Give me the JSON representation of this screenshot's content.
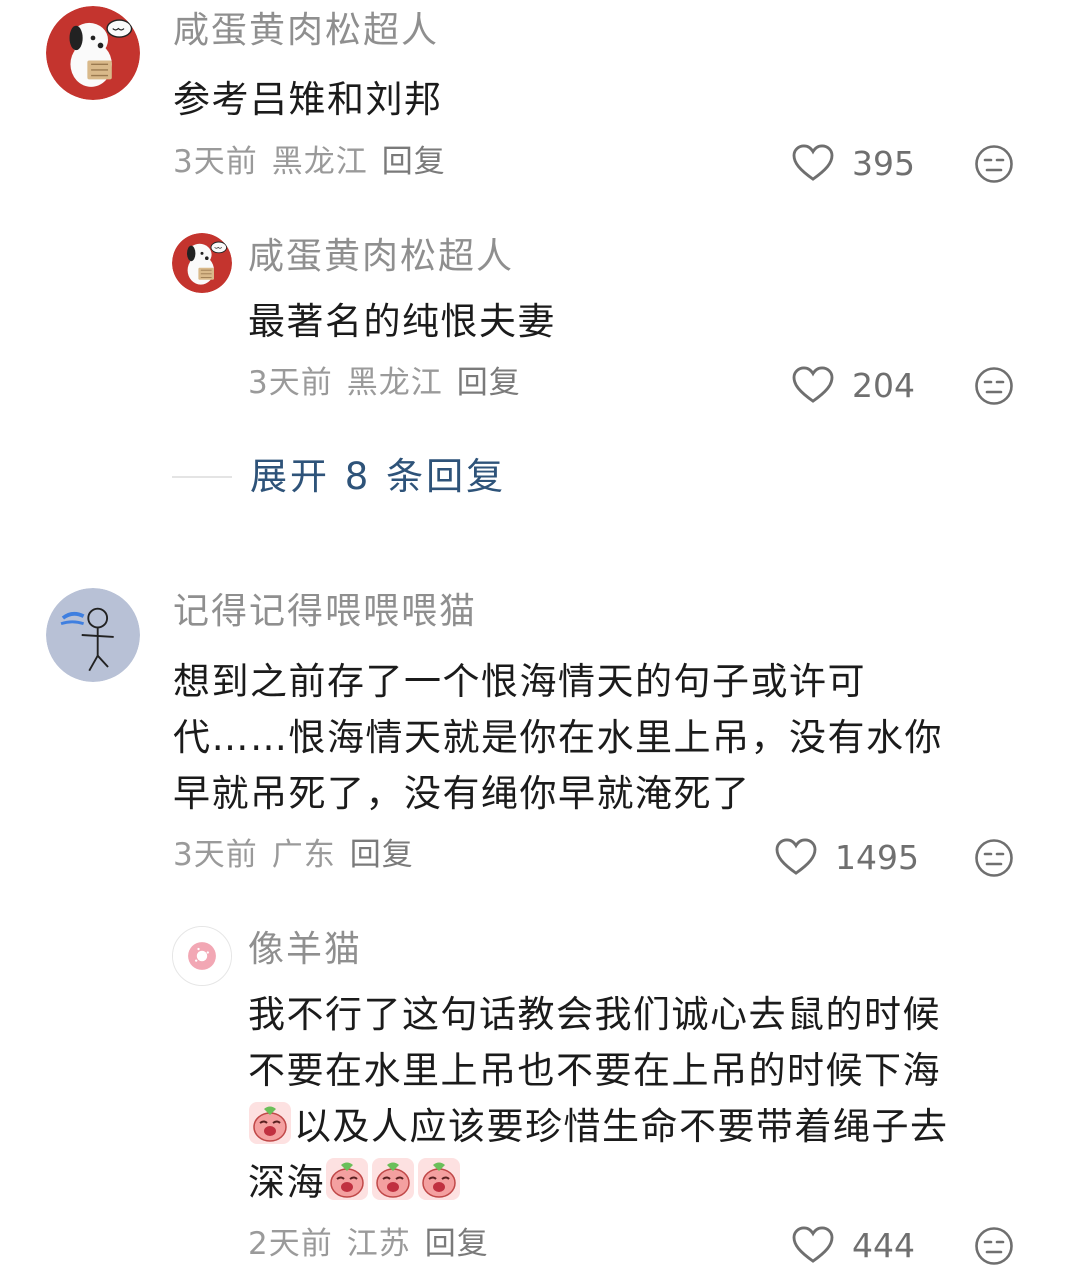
{
  "comments": [
    {
      "username": "咸蛋黄肉松超人",
      "text": "参考吕雉和刘邦",
      "time": "3天前",
      "location": "黑龙江",
      "reply_label": "回复",
      "likes": "395",
      "replies": [
        {
          "username": "咸蛋黄肉松超人",
          "text": "最著名的纯恨夫妻",
          "time": "3天前",
          "location": "黑龙江",
          "reply_label": "回复",
          "likes": "204"
        }
      ],
      "expand_label": "展开 8 条回复"
    },
    {
      "username": "记得记得喂喂喂猫",
      "text_lines": [
        "想到之前存了一个恨海情天的句子或许可",
        "代……恨海情天就是你在水里上吊，没有水你",
        "早就吊死了，没有绳你早就淹死了"
      ],
      "time": "3天前",
      "location": "广东",
      "reply_label": "回复",
      "likes": "1495",
      "replies": [
        {
          "username": "像羊猫",
          "text_lines": [
            "我不行了这句话教会我们诚心去鼠的时候",
            "不要在水里上吊也不要在上吊的时候下海",
            "以及人应该要珍惜生命不要带着绳子去",
            "深海"
          ],
          "time": "2天前",
          "location": "江苏",
          "reply_label": "回复",
          "likes": "444"
        }
      ]
    }
  ],
  "icons": {
    "like": "heart-outline-icon",
    "dislike": "neutral-face-icon",
    "emoji": "crying-peach-emoji"
  },
  "colors": {
    "username": "#8f8f8f",
    "body_text": "#1b1b1b",
    "meta": "#9a9a9a",
    "expand_link": "#2e5379"
  }
}
